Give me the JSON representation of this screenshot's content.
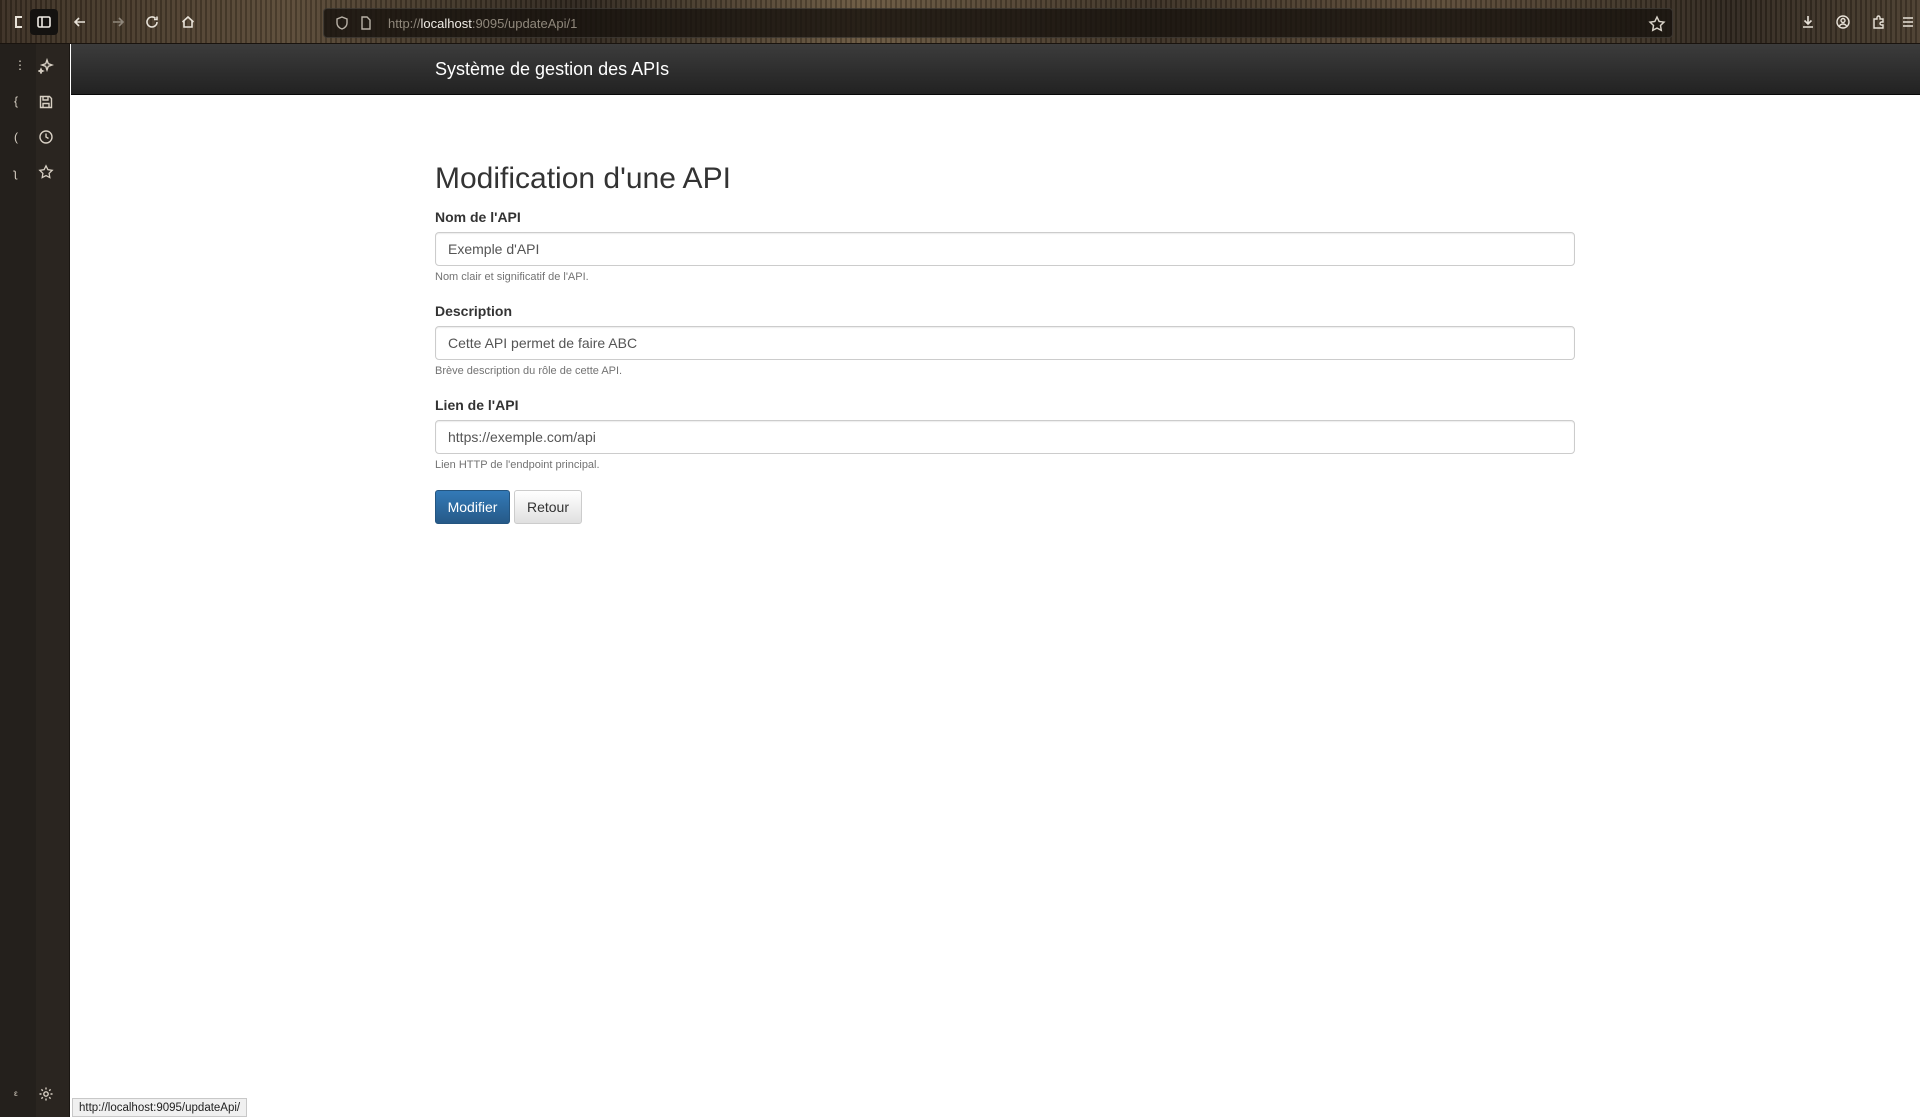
{
  "browser": {
    "url_prefix": "http://",
    "url_host": "localhost",
    "url_rest": ":9095/updateApi/1",
    "status_url": "http://localhost:9095/updateApi/"
  },
  "app": {
    "brand": "Système de gestion des APIs"
  },
  "form": {
    "title": "Modification d'une API",
    "fields": [
      {
        "label": "Nom de l'API",
        "value": "Exemple d'API",
        "help": "Nom clair et significatif de l'API."
      },
      {
        "label": "Description",
        "value": "Cette API permet de faire ABC",
        "help": "Brève description du rôle de cette API."
      },
      {
        "label": "Lien de l'API",
        "value": "https://exemple.com/api",
        "help": "Lien HTTP de l'endpoint principal."
      }
    ],
    "submit_label": "Modifier",
    "back_label": "Retour"
  },
  "colors": {
    "navbar": "#222222",
    "primary": "#337ab7"
  },
  "icons": {
    "sidebar": [
      "sparkle-icon",
      "save-icon",
      "history-icon",
      "star-icon",
      "settings-icon"
    ],
    "toolbar": [
      "back-icon",
      "forward-icon",
      "reload-icon",
      "home-icon",
      "shield-icon",
      "page-icon",
      "bookmark-star-icon",
      "download-icon",
      "account-icon",
      "extensions-icon",
      "menu-icon"
    ]
  }
}
